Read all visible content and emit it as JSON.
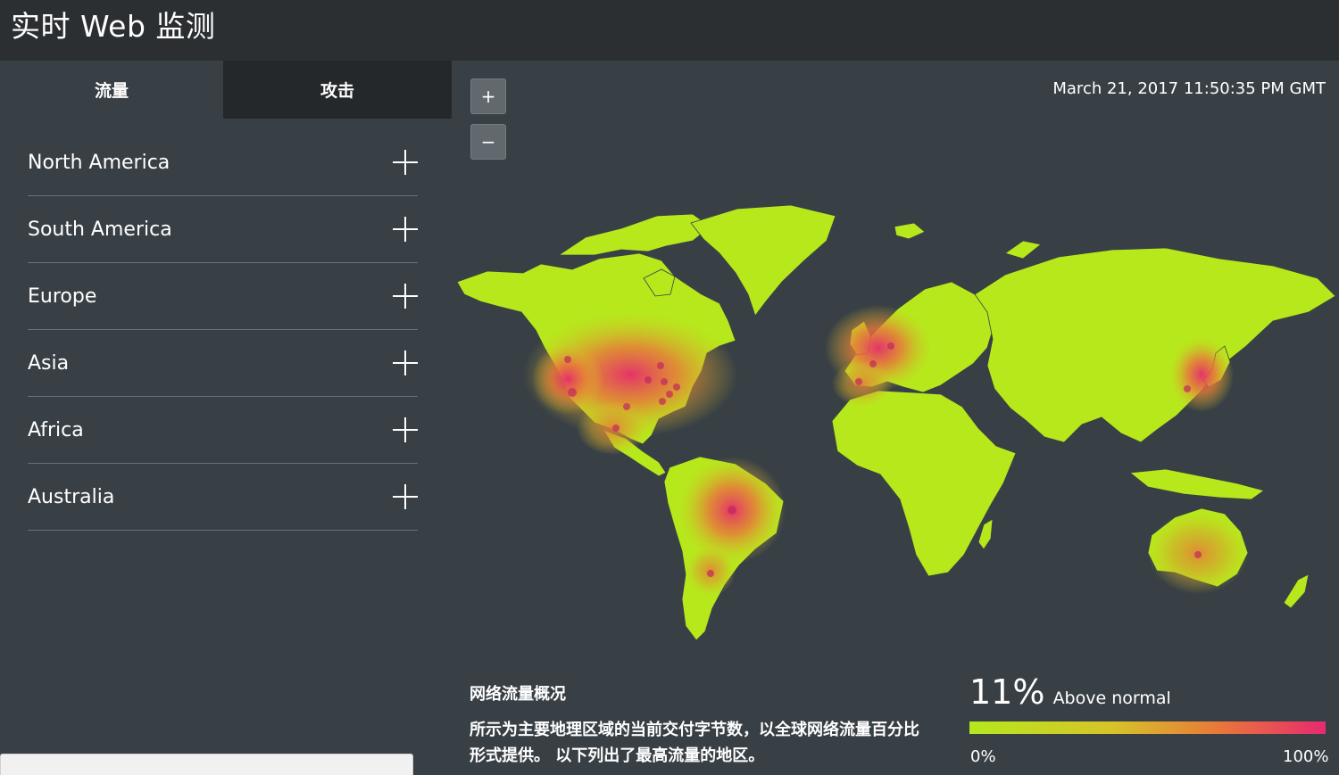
{
  "header": {
    "title": "实时 Web 监测"
  },
  "tabs": [
    {
      "label": "流量",
      "active": true
    },
    {
      "label": "攻击",
      "active": false
    }
  ],
  "regions": [
    {
      "label": "North America"
    },
    {
      "label": "South America"
    },
    {
      "label": "Europe"
    },
    {
      "label": "Asia"
    },
    {
      "label": "Africa"
    },
    {
      "label": "Australia"
    }
  ],
  "zoom": {
    "in_label": "+",
    "out_label": "−"
  },
  "timestamp": "March 21, 2017 11:50:35 PM GMT",
  "overview": {
    "heading": "网络流量概况",
    "description": "所示为主要地理区域的当前交付字节数，以全球网络流量百分比形式提供。 以下列出了最高流量的地区。"
  },
  "stat": {
    "value": "11%",
    "note": "Above normal",
    "scale_min": "0%",
    "scale_max": "100%"
  },
  "colors": {
    "land": "#b6e81c",
    "hot": "#e72a6e",
    "warm": "#e8783a",
    "background": "#394045",
    "header": "#2c2f32"
  }
}
